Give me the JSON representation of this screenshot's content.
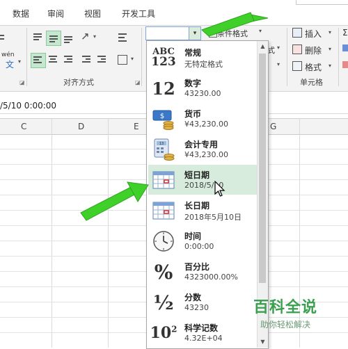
{
  "tabs": [
    "数据",
    "审阅",
    "视图",
    "开发工具"
  ],
  "ribbon": {
    "wen_label": "wén",
    "wen_char": "文",
    "alignment_label": "对齐方式",
    "format_label": "条件格式",
    "style_fragment": "式",
    "insert_label": "插入",
    "delete_label": "删除",
    "format_btn_label": "格式",
    "cells_label": "单元格",
    "number_format_value": ""
  },
  "formula_bar": {
    "content": "/5/10  0:00:00"
  },
  "columns": [
    "C",
    "D",
    "E",
    "G"
  ],
  "dropdown": {
    "items": [
      {
        "name": "常规",
        "example": "无特定格式",
        "icon": "abc-123-icon"
      },
      {
        "name": "数字",
        "example": "43230.00",
        "icon": "number-12-icon"
      },
      {
        "name": "货币",
        "example": "¥43,230.00",
        "icon": "currency-icon"
      },
      {
        "name": "会计专用",
        "example": " ¥43,230.00",
        "icon": "accounting-icon"
      },
      {
        "name": "短日期",
        "example": "2018/5/10",
        "icon": "calendar-icon"
      },
      {
        "name": "长日期",
        "example": "2018年5月10日",
        "icon": "calendar-icon"
      },
      {
        "name": "时间",
        "example": "0:00:00",
        "icon": "clock-icon"
      },
      {
        "name": "百分比",
        "example": "4323000.00%",
        "icon": "percent-icon"
      },
      {
        "name": "分数",
        "example": "43230",
        "icon": "fraction-icon"
      },
      {
        "name": "科学记数",
        "example": "4.32E+04",
        "icon": "scientific-icon"
      }
    ],
    "icon_text": {
      "abc": "ABC",
      "n123": "123",
      "twelve": "12",
      "currency_mark": "$",
      "acc_mark": "13",
      "percent": "%",
      "fraction": "½",
      "sci_base": "10",
      "sci_exp": "2"
    }
  },
  "watermark": {
    "title": "百科全说",
    "subtitle": "助你轻松解决"
  },
  "colors": {
    "highlight": "#d7ecdc",
    "arrow": "#3fd12a",
    "watermark": "#3aa04f"
  }
}
